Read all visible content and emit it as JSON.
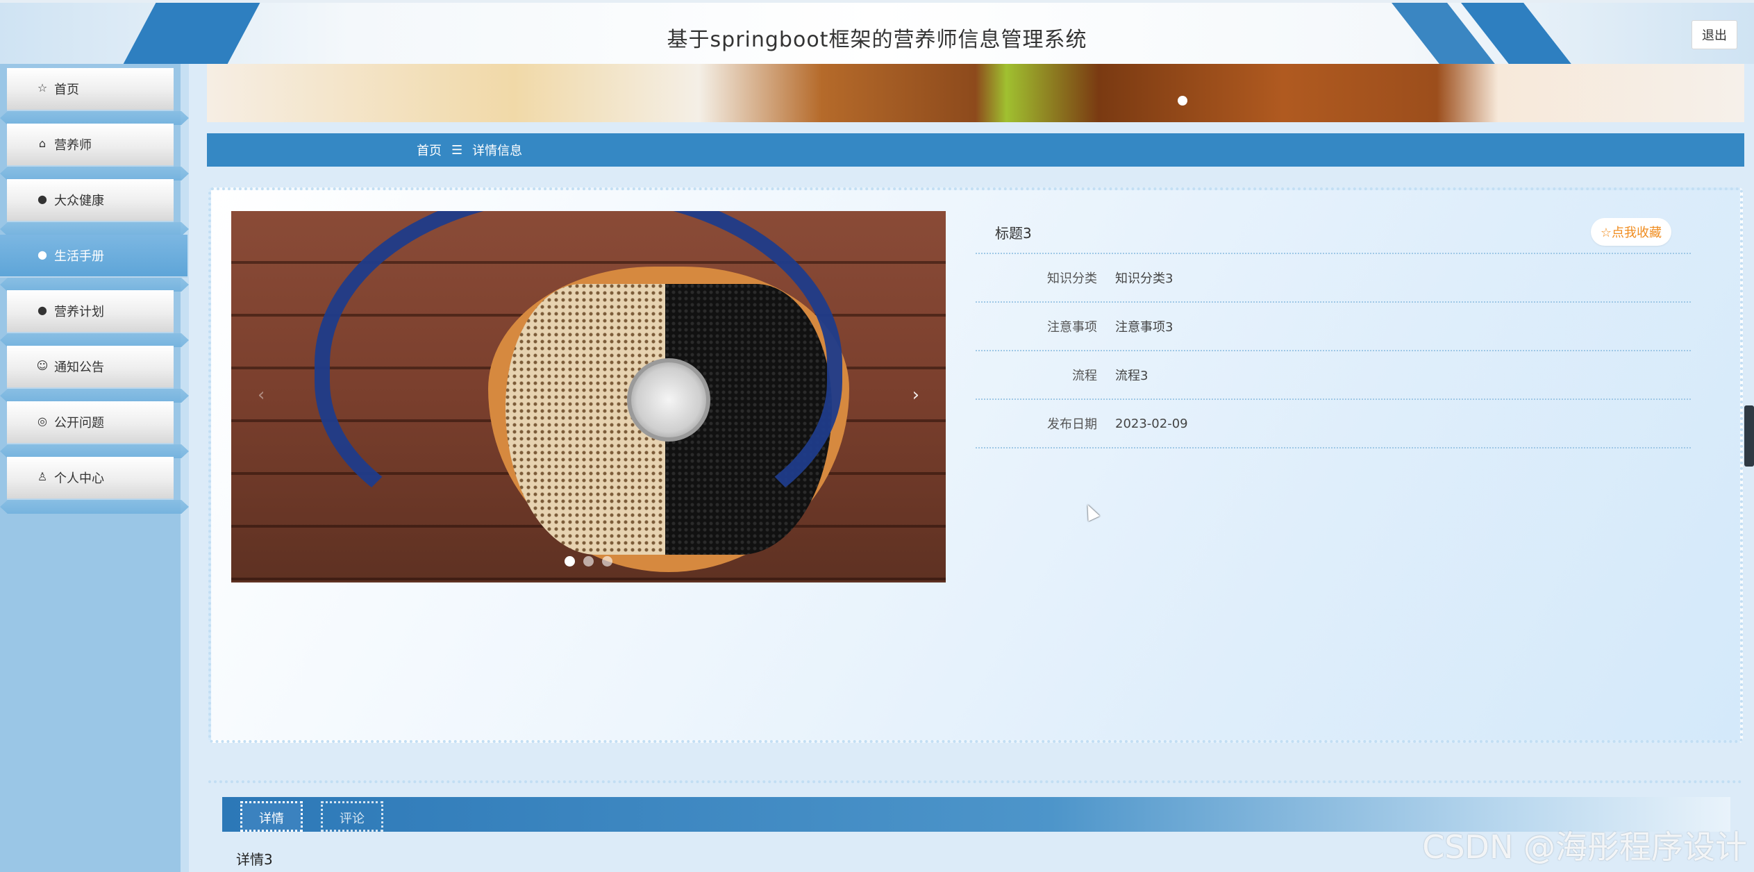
{
  "header": {
    "title": "基于springboot框架的营养师信息管理系统",
    "logout_label": "退出"
  },
  "sidebar": {
    "items": [
      {
        "label": "首页",
        "icon": "star-icon"
      },
      {
        "label": "营养师",
        "icon": "bag-icon"
      },
      {
        "label": "大众健康",
        "icon": "info-circle-icon"
      },
      {
        "label": "生活手册",
        "icon": "circle-icon",
        "active": true
      },
      {
        "label": "营养计划",
        "icon": "info-circle-icon"
      },
      {
        "label": "通知公告",
        "icon": "smile-icon"
      },
      {
        "label": "公开问题",
        "icon": "check-circle-icon"
      },
      {
        "label": "个人中心",
        "icon": "user-icon"
      }
    ]
  },
  "breadcrumb": {
    "home": "首页",
    "separator": "☰",
    "current": "详情信息"
  },
  "detail": {
    "title": "标题3",
    "favorite_label": "☆点我收藏",
    "fields": [
      {
        "label": "知识分类",
        "value": "知识分类3"
      },
      {
        "label": "注意事项",
        "value": "注意事项3"
      },
      {
        "label": "流程",
        "value": "流程3"
      },
      {
        "label": "发布日期",
        "value": "2023-02-09"
      }
    ]
  },
  "carousel": {
    "prev": "‹",
    "next": "›",
    "slide_count": 3,
    "active_slide": 1
  },
  "tabs": [
    {
      "label": "详情"
    },
    {
      "label": "评论"
    }
  ],
  "detail_body": "详情3",
  "watermark": "CSDN @海彤程序设计",
  "colors": {
    "accent": "#3588c4",
    "favorite": "#f08c1e",
    "sidebar": "#9ac6e6"
  }
}
